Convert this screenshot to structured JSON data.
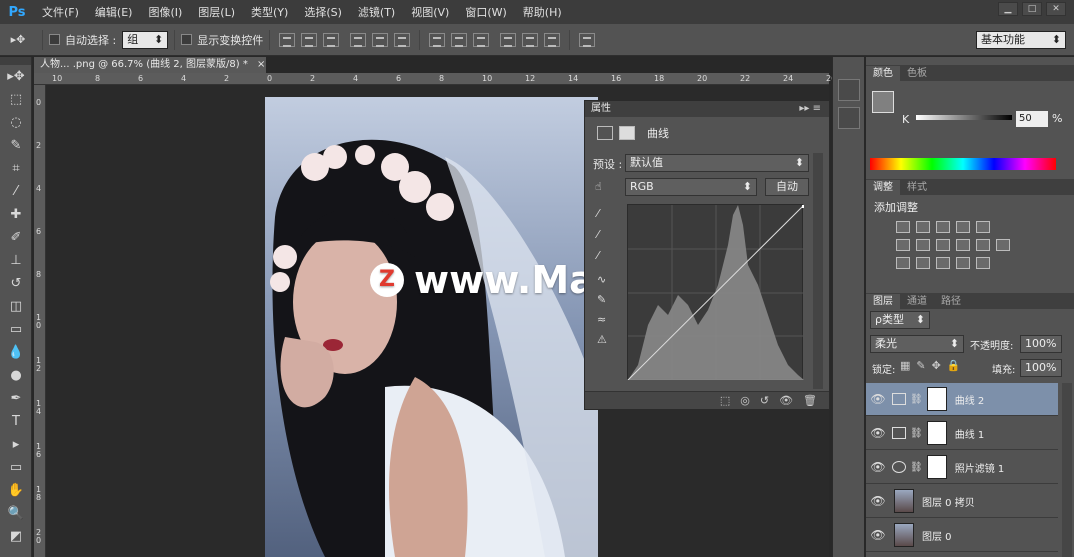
{
  "app": {
    "logo": "Ps"
  },
  "menu": [
    "文件(F)",
    "编辑(E)",
    "图像(I)",
    "图层(L)",
    "类型(Y)",
    "选择(S)",
    "滤镜(T)",
    "视图(V)",
    "窗口(W)",
    "帮助(H)"
  ],
  "options": {
    "auto_select_label": "自动选择 :",
    "auto_select_value": "组",
    "show_transform_label": "显示变换控件",
    "workspace": "基本功能"
  },
  "document": {
    "tab_title": "人物... .png @ 66.7% (曲线 2, 图层蒙版/8) *",
    "close": "×"
  },
  "ruler": {
    "h": [
      "10",
      "8",
      "6",
      "4",
      "2",
      "0",
      "2",
      "4",
      "6",
      "8",
      "10",
      "12",
      "14",
      "16",
      "18",
      "20",
      "22",
      "24",
      "26"
    ],
    "v": [
      "0",
      "2",
      "4",
      "6",
      "8",
      "1\n0",
      "1\n2",
      "1\n4",
      "1\n6",
      "1\n8",
      "2\n0"
    ]
  },
  "properties": {
    "tab": "属性",
    "title": "曲线",
    "preset_label": "预设 :",
    "preset_value": "默认值",
    "channel": "RGB",
    "auto_button": "自动"
  },
  "color_panel": {
    "tabs": [
      "颜色",
      "色板"
    ],
    "channel_label": "K",
    "value": "50",
    "unit": "%"
  },
  "adjustments_panel": {
    "tabs": [
      "调整",
      "样式"
    ],
    "title": "添加调整"
  },
  "layers_panel": {
    "tabs": [
      "图层",
      "通道",
      "路径"
    ],
    "filter": "ρ类型",
    "blend_mode": "柔光",
    "opacity_label": "不透明度:",
    "opacity_value": "100%",
    "lock_label": "锁定:",
    "fill_label": "填充:",
    "fill_value": "100%",
    "layers": [
      {
        "name": "曲线 2",
        "selected": true
      },
      {
        "name": "曲线 1",
        "selected": false
      },
      {
        "name": "照片滤镜 1",
        "selected": false
      },
      {
        "name": "图层 0 拷贝",
        "selected": false
      },
      {
        "name": "图层 0",
        "selected": false
      }
    ]
  },
  "watermark": {
    "logo": "Z",
    "text": "www.MacZ.com"
  }
}
